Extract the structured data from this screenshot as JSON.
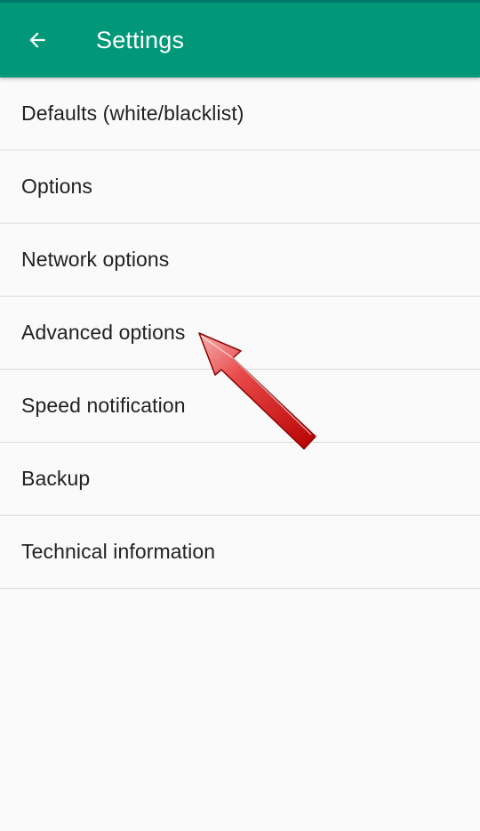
{
  "app_bar": {
    "title": "Settings",
    "back_icon": "arrow-back-icon",
    "background_color": "#009879"
  },
  "settings": {
    "items": [
      {
        "label": "Defaults (white/blacklist)"
      },
      {
        "label": "Options"
      },
      {
        "label": "Network options"
      },
      {
        "label": "Advanced options"
      },
      {
        "label": "Speed notification"
      },
      {
        "label": "Backup"
      },
      {
        "label": "Technical information"
      }
    ]
  },
  "annotation": {
    "icon": "red-pointer-arrow",
    "color": "#e30000"
  }
}
